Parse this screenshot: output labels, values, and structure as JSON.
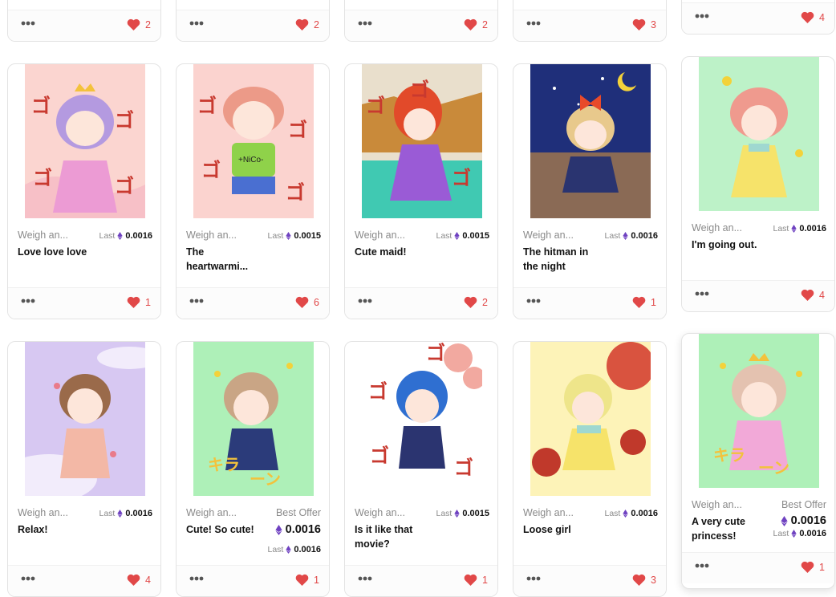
{
  "theme": {
    "heart_color": "#e14848",
    "eth_color": "#6f42c1"
  },
  "icons": {
    "more": "more-dots-icon",
    "like": "heart-icon",
    "currency": "ethereum-icon"
  },
  "top_row_likes": [
    "2",
    "2",
    "2",
    "3",
    "4"
  ],
  "cards": [
    {
      "collection": "Weigh an...",
      "last_label": "Last",
      "last_price": "0.0016",
      "title": "Love love love",
      "likes": "1"
    },
    {
      "collection": "Weigh an...",
      "last_label": "Last",
      "last_price": "0.0015",
      "title": "The heartwarmi...",
      "likes": "6"
    },
    {
      "collection": "Weigh an...",
      "last_label": "Last",
      "last_price": "0.0015",
      "title": "Cute maid!",
      "likes": "2"
    },
    {
      "collection": "Weigh an...",
      "last_label": "Last",
      "last_price": "0.0016",
      "title": "The hitman in the night",
      "likes": "1"
    },
    {
      "collection": "Weigh an...",
      "last_label": "Last",
      "last_price": "0.0016",
      "title": "I'm going out.",
      "likes": "4"
    },
    {
      "collection": "Weigh an...",
      "last_label": "Last",
      "last_price": "0.0016",
      "title": "Relax!",
      "likes": "4"
    },
    {
      "collection": "Weigh an...",
      "best_offer_label": "Best Offer",
      "best_offer_price": "0.0016",
      "last_label": "Last",
      "last_price": "0.0016",
      "title": "Cute! So cute!",
      "likes": "1"
    },
    {
      "collection": "Weigh an...",
      "last_label": "Last",
      "last_price": "0.0015",
      "title": "Is it like that movie?",
      "likes": "1"
    },
    {
      "collection": "Weigh an...",
      "last_label": "Last",
      "last_price": "0.0016",
      "title": "Loose girl",
      "likes": "3"
    },
    {
      "collection": "Weigh an...",
      "best_offer_label": "Best Offer",
      "best_offer_price": "0.0016",
      "last_label": "Last",
      "last_price": "0.0016",
      "title": "A very cute princess!",
      "likes": "1"
    }
  ]
}
